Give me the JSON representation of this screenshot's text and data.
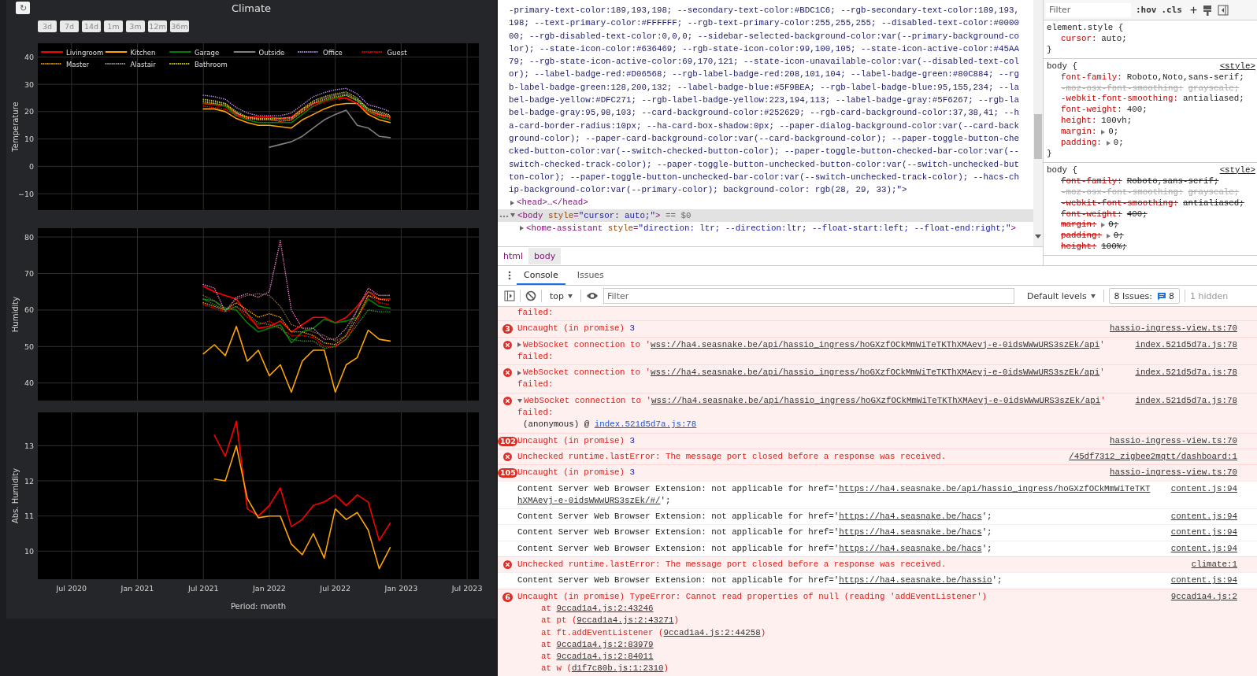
{
  "climate": {
    "refresh_button": "↻",
    "title": "Climate",
    "ranges": [
      {
        "label": "3d"
      },
      {
        "label": "7d"
      },
      {
        "label": "14d"
      },
      {
        "label": "1m"
      },
      {
        "label": "3m"
      },
      {
        "label": "12m"
      },
      {
        "label": "36m"
      }
    ],
    "panels": [
      {
        "chart_data": {
          "type": "line",
          "grid": true,
          "legend": "top-left",
          "ylabel": "Temperature",
          "x": [
            "2021-07-01",
            "2021-08-01",
            "2021-09-01",
            "2021-10-01",
            "2021-11-01",
            "2021-12-01",
            "2022-01-01",
            "2022-02-01",
            "2022-03-01",
            "2022-04-01",
            "2022-05-01",
            "2022-06-01",
            "2022-07-01",
            "2022-08-01",
            "2022-09-01",
            "2022-10-01",
            "2022-11-01",
            "2022-12-01"
          ],
          "xlim": [
            "2020-03-29",
            "2023-08-03"
          ],
          "ylim": [
            -16,
            45
          ],
          "yticks": [
            {
              "value": -10,
              "label": "−10"
            },
            {
              "value": 0,
              "label": "0"
            },
            {
              "value": 10,
              "label": "10"
            },
            {
              "value": 20,
              "label": "20"
            },
            {
              "value": 30,
              "label": "30"
            },
            {
              "value": 40,
              "label": "40"
            }
          ],
          "series": [
            {
              "name": "Livingroom",
              "color": "#ff0000",
              "line_style": "solid",
              "values": [
                23,
                22.5,
                22,
                19,
                18,
                18,
                18,
                17.5,
                18,
                21,
                23,
                24,
                25,
                25,
                23,
                20,
                19,
                18
              ]
            },
            {
              "name": "Kitchen",
              "color": "#ffa500",
              "line_style": "solid",
              "values": [
                21,
                21,
                20,
                17.5,
                16,
                15,
                15,
                14.5,
                14,
                17,
                19,
                21,
                22.5,
                23,
                23,
                19,
                17,
                16
              ]
            },
            {
              "name": "Garage",
              "color": "#008000",
              "line_style": "solid",
              "values": [
                23,
                23,
                22,
                18.5,
                17,
                16,
                16,
                16,
                16,
                19,
                22,
                24,
                25,
                26,
                24,
                20,
                18,
                17
              ]
            },
            {
              "name": "Outside",
              "color": "#808080",
              "line_style": "solid",
              "values": [
                null,
                null,
                null,
                null,
                null,
                null,
                7,
                8,
                9,
                11,
                14,
                17,
                19,
                20.5,
                15,
                14,
                11,
                10.5
              ]
            },
            {
              "name": "Office",
              "color": "#b68ee6",
              "line_style": "dotted",
              "values": [
                26,
                25.5,
                24.5,
                21.5,
                19.5,
                18.5,
                18.5,
                18.5,
                19.5,
                22.5,
                25.5,
                27,
                28,
                28.5,
                26.5,
                22.5,
                21.5,
                20
              ]
            },
            {
              "name": "Guest",
              "color": "#ff0000",
              "line_style": "dotted",
              "values": [
                22,
                21.5,
                21,
                18.5,
                17.5,
                17.5,
                17.5,
                16.3,
                17,
                20,
                22,
                23.5,
                24.5,
                24.8,
                23,
                19.5,
                18.5,
                17.5
              ]
            },
            {
              "name": "Master",
              "color": "#ffa500",
              "line_style": "dotted",
              "values": [
                23.5,
                23,
                22.5,
                19.5,
                17.5,
                17,
                17,
                16.5,
                17,
                20,
                23,
                24.5,
                25.5,
                26,
                24,
                20.5,
                19,
                18
              ]
            },
            {
              "name": "Alastair",
              "color": "#a0a0a0",
              "line_style": "dotted",
              "values": [
                24,
                23.5,
                23,
                19.5,
                18,
                17.2,
                17.2,
                17.2,
                17.5,
                20.5,
                23.5,
                25,
                26,
                26.5,
                24.5,
                21,
                19.5,
                18.5
              ]
            },
            {
              "name": "Bathroom",
              "color": "#d4d420",
              "line_style": "dotted",
              "values": [
                24.5,
                24,
                23,
                20,
                18,
                17.5,
                17.5,
                17.6,
                17.8,
                21,
                24,
                25.5,
                26.5,
                27.2,
                25,
                21,
                20,
                18.8
              ]
            }
          ]
        }
      },
      {
        "chart_data": {
          "type": "line",
          "grid": true,
          "ylabel": "Humidity",
          "x": [
            "2021-07-01",
            "2021-08-01",
            "2021-09-01",
            "2021-10-01",
            "2021-11-01",
            "2021-12-01",
            "2022-01-01",
            "2022-02-01",
            "2022-03-01",
            "2022-04-01",
            "2022-05-01",
            "2022-06-01",
            "2022-07-01",
            "2022-08-01",
            "2022-09-01",
            "2022-10-01",
            "2022-11-01",
            "2022-12-01"
          ],
          "xlim": [
            "2020-03-29",
            "2023-08-03"
          ],
          "ylim": [
            35.2,
            82.4
          ],
          "yticks": [
            {
              "value": 40,
              "label": "40"
            },
            {
              "value": 50,
              "label": "50"
            },
            {
              "value": 60,
              "label": "60"
            },
            {
              "value": 70,
              "label": "70"
            },
            {
              "value": 80,
              "label": "80"
            }
          ],
          "series": [
            {
              "color": "#ff0000",
              "line_style": "solid",
              "values": [
                66.5,
                65,
                64,
                63,
                59,
                55,
                55.5,
                57,
                54,
                56,
                58,
                58,
                56.5,
                58,
                61,
                65,
                63,
                63
              ]
            },
            {
              "color": "#ffa500",
              "line_style": "solid",
              "values": [
                48,
                50.5,
                47.5,
                55.5,
                46,
                49,
                42,
                45,
                37.5,
                46,
                49,
                49,
                37.5,
                45,
                47,
                54.5,
                52,
                51.5
              ]
            },
            {
              "color": "#008000",
              "line_style": "solid",
              "values": [
                63,
                62.5,
                60.5,
                60,
                56.5,
                54,
                55,
                56,
                51,
                54,
                55,
                57.5,
                56.5,
                57,
                58,
                63,
                61,
                60.5
              ]
            },
            {
              "color": "#e377c2",
              "line_style": "dotted",
              "values": [
                67,
                66,
                59.5,
                63.5,
                64.5,
                63.5,
                65,
                79,
                60,
                55,
                55,
                52,
                52,
                55,
                60,
                66,
                64,
                64
              ]
            },
            {
              "color": "#ff0000",
              "line_style": "dotted",
              "values": [
                61.5,
                60.5,
                59.5,
                61,
                58,
                56,
                57,
                55,
                53,
                53,
                52.5,
                50,
                50,
                52,
                57,
                64,
                62,
                61.5
              ]
            },
            {
              "color": "#ffa500",
              "line_style": "dotted",
              "values": [
                62,
                61,
                60,
                62,
                60,
                58,
                59,
                58,
                54,
                54,
                53,
                51,
                50.5,
                53,
                58,
                64,
                63,
                62.5
              ]
            },
            {
              "color": "#8c6a4b",
              "line_style": "dotted",
              "values": [
                64,
                62.5,
                60,
                63,
                64,
                64.5,
                64,
                61,
                56,
                55,
                54,
                53,
                51.5,
                53,
                60,
                65,
                64,
                64
              ]
            },
            {
              "color": "#2ca02c",
              "line_style": "dotted",
              "values": [
                63,
                61.5,
                60,
                61,
                59,
                56.5,
                56,
                55,
                52,
                51.5,
                51.5,
                49.5,
                50,
                52,
                56,
                60,
                59.5,
                59.5
              ]
            }
          ]
        }
      },
      {
        "chart_data": {
          "type": "line",
          "grid": true,
          "ylabel": "Abs. Humidity",
          "xlabel": "Period: month",
          "x": [
            "2021-08-01",
            "2021-09-01",
            "2021-10-01",
            "2021-11-01",
            "2021-12-01",
            "2022-01-01",
            "2022-02-01",
            "2022-03-01",
            "2022-04-01",
            "2022-05-01",
            "2022-06-01",
            "2022-07-01",
            "2022-08-01",
            "2022-09-01",
            "2022-10-01",
            "2022-11-01",
            "2022-12-01"
          ],
          "xlim": [
            "2020-03-29",
            "2023-08-03"
          ],
          "ylim": [
            9.2,
            13.95
          ],
          "xticks": [
            {
              "value": "2020-07-01",
              "label": "Jul 2020"
            },
            {
              "value": "2021-01-01",
              "label": "Jan 2021"
            },
            {
              "value": "2021-07-01",
              "label": "Jul 2021"
            },
            {
              "value": "2022-01-01",
              "label": "Jan 2022"
            },
            {
              "value": "2022-07-01",
              "label": "Jul 2022"
            },
            {
              "value": "2023-01-01",
              "label": "Jan 2023"
            },
            {
              "value": "2023-07-01",
              "label": "Jul 2023"
            }
          ],
          "yticks": [
            {
              "value": 10,
              "label": "10"
            },
            {
              "value": 11,
              "label": "11"
            },
            {
              "value": 12,
              "label": "12"
            },
            {
              "value": 13,
              "label": "13"
            }
          ],
          "series": [
            {
              "color": "#ff0000",
              "line_style": "solid",
              "values": [
                13.3,
                12.7,
                13.7,
                11.2,
                11,
                11.3,
                11.8,
                10.7,
                10.9,
                11.3,
                11.4,
                11.6,
                11.3,
                11.6,
                11.4,
                10.3,
                10.8
              ]
            },
            {
              "color": "#ffa500",
              "line_style": "solid",
              "values": [
                12.05,
                12,
                13,
                11.5,
                10.95,
                11,
                11,
                10.2,
                9.9,
                10.5,
                9.8,
                11.2,
                10.9,
                11.1,
                10.6,
                9.5,
                10.1
              ]
            }
          ]
        }
      }
    ]
  },
  "elements": {
    "lines": [
      "-primary-text-color:189,193,198; --secondary-text-color:#BDC1C6; --rgb-secondary-text-color:189,193,",
      "198; --text-primary-color:#FFFFFF; --rgb-text-primary-color:255,255,255; --disabled-text-color:#0000",
      "00; --rgb-disabled-text-color:0,0,0; --sidebar-selected-background-color:var(--primary-background-co",
      "lor); --state-icon-color:#636469; --rgb-state-icon-color:99,100,105; --state-icon-active-color:#45AA",
      "79; --rgb-state-icon-active-color:69,170,121; --state-icon-unavailable-color:var(--disabled-text-col",
      "or); --label-badge-red:#D06568; --rgb-label-badge-red:208,101,104; --label-badge-green:#80C884; --rg",
      "b-label-badge-green:128,200,132; --label-badge-blue:#5F9BEA; --rgb-label-badge-blue:95,155,234; --la",
      "bel-badge-yellow:#DFC271; --rgb-label-badge-yellow:223,194,113; --label-badge-gray:#5F6267; --rgb-la",
      "bel-badge-gray:95,98,103; --card-background-color:#252629; --rgb-card-background-color:37,38,41; --h",
      "a-card-border-radius:10px; --ha-card-box-shadow:0px; --paper-dialog-background-color:var(--card-back",
      "ground-color); --paper-card-background-color:var(--card-background-color); --paper-toggle-button-che",
      "cked-button-color:var(--switch-checked-button-color); --paper-toggle-button-checked-bar-color:var(--",
      "switch-checked-track-color); --paper-toggle-button-unchecked-button-color:var(--switch-unchecked-but",
      "ton-color); --paper-toggle-button-unchecked-bar-color:var(--switch-unchecked-track-color); --hacs-ch",
      "ip-background-color:var(--primary-color); background-color: rgb(28, 29, 33);\">"
    ],
    "nodes": [
      {
        "expanded": false,
        "selected": false,
        "parts": [
          {
            "kind": "tag",
            "text": "<head>…</head>"
          }
        ]
      },
      {
        "expanded": true,
        "selected": true,
        "parts": [
          {
            "kind": "tag",
            "text": "<body"
          },
          {
            "kind": "attr",
            "text": "style"
          },
          {
            "kind": "tag",
            "text": "="
          },
          {
            "kind": "value",
            "text": "\"cursor: auto;\""
          },
          {
            "kind": "tag",
            "text": ">"
          },
          {
            "kind": "marker",
            "text": "== $0"
          }
        ],
        "children": [
          {
            "expanded": false,
            "selected": false,
            "parts": [
              {
                "kind": "tag",
                "text": "<home-assistant"
              },
              {
                "kind": "attr",
                "text": "style"
              },
              {
                "kind": "tag",
                "text": "="
              },
              {
                "kind": "value",
                "text": "\"direction: ltr; --direction:ltr; --float-start:left; --float-end:right;\""
              },
              {
                "kind": "tag",
                "text": ">"
              }
            ]
          }
        ]
      }
    ],
    "breadcrumbs": [
      {
        "label": "html",
        "selected": false
      },
      {
        "label": "body",
        "selected": true
      }
    ]
  },
  "styles": {
    "filter_placeholder": "Filter",
    "hov": ":hov",
    "cls": ".cls",
    "add": "+",
    "rules": [
      {
        "selector": "element.style {",
        "props": [
          {
            "name": "cursor:",
            "value": "auto;",
            "struck": false,
            "invalid": false,
            "expandable": false
          }
        ],
        "close": "}"
      },
      {
        "selector": "body {",
        "source": "<style>",
        "props": [
          {
            "name": "font-family:",
            "value": "Roboto,Noto,sans-serif;",
            "struck": false,
            "invalid": false,
            "expandable": false
          },
          {
            "name": "-moz-osx-font-smoothing:",
            "value": "grayscale;",
            "struck": true,
            "invalid": true,
            "expandable": false
          },
          {
            "name": "-webkit-font-smoothing:",
            "value": "antialiased;",
            "struck": false,
            "invalid": false,
            "expandable": false
          },
          {
            "name": "font-weight:",
            "value": "400;",
            "struck": false,
            "invalid": false,
            "expandable": false
          },
          {
            "name": "height:",
            "value": "100vh;",
            "struck": false,
            "invalid": false,
            "expandable": false
          },
          {
            "name": "margin:",
            "value": "0;",
            "struck": false,
            "invalid": false,
            "expandable": true
          },
          {
            "name": "padding:",
            "value": "0;",
            "struck": false,
            "invalid": false,
            "expandable": true
          }
        ],
        "close": "}"
      },
      {
        "selector": "body {",
        "source": "<style>",
        "props": [
          {
            "name": "font-family:",
            "value": "Roboto,sans-serif;",
            "struck": true,
            "invalid": false,
            "expandable": false
          },
          {
            "name": "-moz-osx-font-smoothing:",
            "value": "grayscale;",
            "struck": true,
            "invalid": true,
            "expandable": false
          },
          {
            "name": "-webkit-font-smoothing:",
            "value": "antialiased;",
            "struck": true,
            "invalid": false,
            "expandable": false
          },
          {
            "name": "font-weight:",
            "value": "400;",
            "struck": true,
            "invalid": false,
            "expandable": false
          },
          {
            "name": "margin:",
            "value": "0;",
            "struck": true,
            "invalid": false,
            "expandable": true
          },
          {
            "name": "padding:",
            "value": "0;",
            "struck": true,
            "invalid": false,
            "expandable": true
          },
          {
            "name": "height:",
            "value": "100%;",
            "struck": true,
            "invalid": false,
            "expandable": false
          }
        ]
      }
    ]
  },
  "console": {
    "tabs": [
      {
        "label": "Console",
        "selected": true
      },
      {
        "label": "Issues",
        "selected": false
      }
    ],
    "toolbar": {
      "context": "top",
      "filter_placeholder": "Filter",
      "levels": "Default levels",
      "issues_label": "8 Issues:",
      "issues_count": "8",
      "hidden": "1 hidden"
    },
    "messages": [
      {
        "kind": "error-tail",
        "lines": [
          {
            "kind": "main",
            "parts": [
              {
                "kind": "text",
                "text": "failed:"
              }
            ]
          }
        ]
      },
      {
        "kind": "error",
        "count": "3",
        "lines": [
          {
            "kind": "main",
            "parts": [
              {
                "kind": "text",
                "text": "Uncaught (in promise)"
              },
              {
                "kind": "value",
                "text": "3"
              }
            ]
          }
        ],
        "source": "hassio-ingress-view.ts:70"
      },
      {
        "kind": "error",
        "expanded": false,
        "lines": [
          {
            "kind": "main",
            "parts": [
              {
                "kind": "text",
                "text": "WebSocket connection to '"
              },
              {
                "kind": "link",
                "text": "wss://ha4.seasnake.be/api/hassio_ingress/hoGXzfOCkMmWiTeTKThXMAevj-e-0idsWWwURS3szEk/api"
              },
              {
                "kind": "text",
                "text": "'"
              }
            ]
          },
          {
            "kind": "main",
            "parts": [
              {
                "kind": "text",
                "text": "failed:"
              }
            ]
          }
        ],
        "source": "index.521d5d7a.js:78"
      },
      {
        "kind": "error",
        "expanded": false,
        "lines": [
          {
            "kind": "main",
            "parts": [
              {
                "kind": "text",
                "text": "WebSocket connection to '"
              },
              {
                "kind": "link",
                "text": "wss://ha4.seasnake.be/api/hassio_ingress/hoGXzfOCkMmWiTeTKThXMAevj-e-0idsWWwURS3szEk/api"
              },
              {
                "kind": "text",
                "text": "'"
              }
            ]
          },
          {
            "kind": "main",
            "parts": [
              {
                "kind": "text",
                "text": "failed:"
              }
            ]
          }
        ],
        "source": "index.521d5d7a.js:78"
      },
      {
        "kind": "error",
        "expanded": true,
        "lines": [
          {
            "kind": "main",
            "parts": [
              {
                "kind": "text",
                "text": "WebSocket connection to '"
              },
              {
                "kind": "link",
                "text": "wss://ha4.seasnake.be/api/hassio_ingress/hoGXzfOCkMmWiTeTKThXMAevj-e-0idsWWwURS3szEk/api"
              },
              {
                "kind": "text",
                "text": "'"
              }
            ]
          },
          {
            "kind": "main",
            "parts": [
              {
                "kind": "text",
                "text": "failed:"
              }
            ]
          },
          {
            "kind": "call",
            "parts": [
              {
                "kind": "plain",
                "text": "(anonymous) @"
              },
              {
                "kind": "bluelink",
                "text": "index.521d5d7a.js:78"
              }
            ]
          }
        ],
        "source": "index.521d5d7a.js:78"
      },
      {
        "kind": "error",
        "count": "102",
        "lines": [
          {
            "kind": "main",
            "parts": [
              {
                "kind": "text",
                "text": "Uncaught (in promise)"
              },
              {
                "kind": "value",
                "text": "3"
              }
            ]
          }
        ],
        "source": "hassio-ingress-view.ts:70"
      },
      {
        "kind": "error",
        "lines": [
          {
            "kind": "main",
            "parts": [
              {
                "kind": "text",
                "text": "Unchecked runtime.lastError: The message port closed before a response was received."
              }
            ]
          }
        ],
        "source": "/45df7312_zigbee2mqtt/dashboard:1"
      },
      {
        "kind": "error",
        "count": "105",
        "lines": [
          {
            "kind": "main",
            "parts": [
              {
                "kind": "text",
                "text": "Uncaught (in promise)"
              },
              {
                "kind": "value",
                "text": "3"
              }
            ]
          }
        ],
        "source": "hassio-ingress-view.ts:70"
      },
      {
        "kind": "log",
        "lines": [
          {
            "kind": "main",
            "parts": [
              {
                "kind": "text",
                "text": "Content Server Web Browser Extension: not applicable for href='"
              },
              {
                "kind": "link",
                "text": "https://ha4.seasnake.be/api/hassio_ingress/hoGXzfOCkMmWiTeTKT"
              }
            ]
          },
          {
            "kind": "main",
            "parts": [
              {
                "kind": "link",
                "text": "hXMAevj-e-0idsWWwURS3szEk/#/"
              },
              {
                "kind": "text",
                "text": "';"
              }
            ]
          }
        ],
        "source": "content.js:94"
      },
      {
        "kind": "log",
        "lines": [
          {
            "kind": "main",
            "parts": [
              {
                "kind": "text",
                "text": "Content Server Web Browser Extension: not applicable for href='"
              },
              {
                "kind": "link",
                "text": "https://ha4.seasnake.be/hacs"
              },
              {
                "kind": "text",
                "text": "';"
              }
            ]
          }
        ],
        "source": "content.js:94"
      },
      {
        "kind": "log",
        "lines": [
          {
            "kind": "main",
            "parts": [
              {
                "kind": "text",
                "text": "Content Server Web Browser Extension: not applicable for href='"
              },
              {
                "kind": "link",
                "text": "https://ha4.seasnake.be/hacs"
              },
              {
                "kind": "text",
                "text": "';"
              }
            ]
          }
        ],
        "source": "content.js:94"
      },
      {
        "kind": "log",
        "lines": [
          {
            "kind": "main",
            "parts": [
              {
                "kind": "text",
                "text": "Content Server Web Browser Extension: not applicable for href='"
              },
              {
                "kind": "link",
                "text": "https://ha4.seasnake.be/hacs"
              },
              {
                "kind": "text",
                "text": "';"
              }
            ]
          }
        ],
        "source": "content.js:94"
      },
      {
        "kind": "error",
        "lines": [
          {
            "kind": "main",
            "parts": [
              {
                "kind": "text",
                "text": "Unchecked runtime.lastError: The message port closed before a response was received."
              }
            ]
          }
        ],
        "source": "climate:1"
      },
      {
        "kind": "log",
        "lines": [
          {
            "kind": "main",
            "parts": [
              {
                "kind": "text",
                "text": "Content Server Web Browser Extension: not applicable for href='"
              },
              {
                "kind": "link",
                "text": "https://ha4.seasnake.be/hassio"
              },
              {
                "kind": "text",
                "text": "';"
              }
            ]
          }
        ],
        "source": "content.js:94"
      },
      {
        "kind": "error",
        "count": "6",
        "lines": [
          {
            "kind": "main",
            "parts": [
              {
                "kind": "text",
                "text": "Uncaught (in promise) TypeError: Cannot read properties of null (reading 'addEventListener')"
              }
            ]
          },
          {
            "kind": "trace",
            "parts": [
              {
                "kind": "text",
                "text": "at "
              },
              {
                "kind": "link",
                "text": "9ccad1a4.js:2:43246"
              }
            ]
          },
          {
            "kind": "trace",
            "parts": [
              {
                "kind": "text",
                "text": "at pt ("
              },
              {
                "kind": "link",
                "text": "9ccad1a4.js:2:43271"
              },
              {
                "kind": "text",
                "text": ")"
              }
            ]
          },
          {
            "kind": "trace",
            "parts": [
              {
                "kind": "text",
                "text": "at ft.addEventListener ("
              },
              {
                "kind": "link",
                "text": "9ccad1a4.js:2:44258"
              },
              {
                "kind": "text",
                "text": ")"
              }
            ]
          },
          {
            "kind": "trace",
            "parts": [
              {
                "kind": "text",
                "text": "at "
              },
              {
                "kind": "link",
                "text": "9ccad1a4.js:2:83979"
              }
            ]
          },
          {
            "kind": "trace",
            "parts": [
              {
                "kind": "text",
                "text": "at "
              },
              {
                "kind": "link",
                "text": "9ccad1a4.js:2:84011"
              }
            ]
          },
          {
            "kind": "trace",
            "parts": [
              {
                "kind": "text",
                "text": "at w ("
              },
              {
                "kind": "link",
                "text": "d1f7c80b.js:1:2310"
              },
              {
                "kind": "text",
                "text": ")"
              }
            ]
          }
        ],
        "source": "9ccad1a4.js:2"
      }
    ]
  }
}
